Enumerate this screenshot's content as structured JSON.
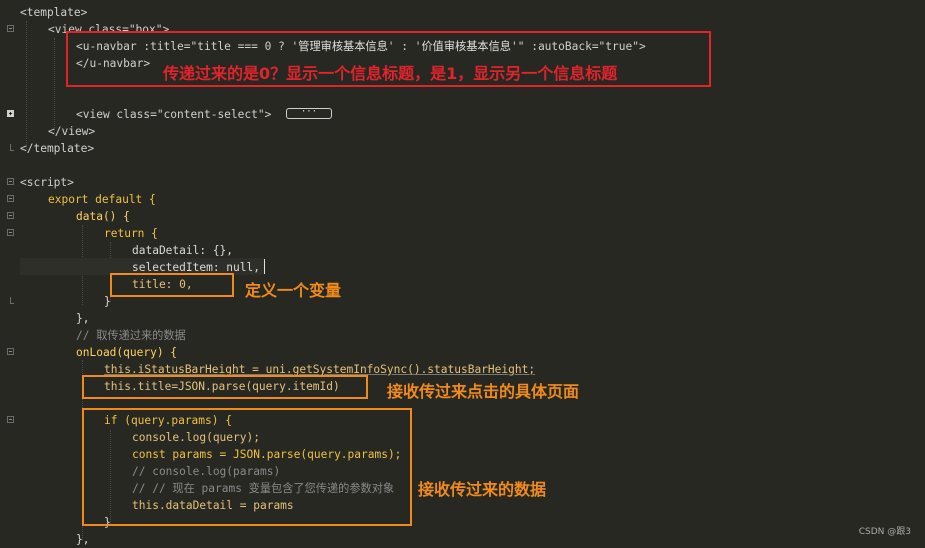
{
  "code": {
    "template_open": "<template>",
    "view_box": "<view class=\"box\">",
    "navbar_l1_a": "<u-navbar :title=\"title === 0 ? '",
    "navbar_l1_cn1": "管理审核基本信息",
    "navbar_l1_b": "' : '",
    "navbar_l1_cn2": "价值审核基本信息",
    "navbar_l1_c": "'\" :autoBack=\"true\">",
    "navbar_close": "</u-navbar>",
    "view_content": "<view class=\"content-select\">",
    "collapsed_marker": "···",
    "view_close": "</view>",
    "template_close": "</template>",
    "script_open": "<script>",
    "export_default": "export default {",
    "data_fn": "data() {",
    "return_open": "return {",
    "data_detail": "dataDetail: {},",
    "selected_item": "selectedItem: null,",
    "title_prop": "title: 0,",
    "close_brace": "}",
    "close_brace_comma": "},",
    "comment_fetch": "// 取传递过来的数据",
    "onload": "onLoad(query) {",
    "status_bar": "this.iStatusBarHeight = uni.getSystemInfoSync().statusBarHeight;",
    "this_title": "this.title=JSON.parse(query.itemId)",
    "if_params": "if (query.params) {",
    "console_log": "console.log(query);",
    "const_params": "const params = JSON.parse(query.params);",
    "comment_console": "// console.log(params)",
    "comment_now": "// // 现在 params 变量包含了您传递的参数对象",
    "data_detail_assign": "this.dataDetail = params",
    "if_close": "}",
    "last_brace": "},"
  },
  "annotations": {
    "title_explain": "传递过来的是0？显示一个信息标题，是1，显示另一个信息标题",
    "define_var": "定义一个变量",
    "receive_page": "接收传过来点击的具体页面",
    "receive_data": "接收传过来的数据"
  },
  "watermark": "CSDN @跟3",
  "colors": {
    "background": "#272822",
    "red_box": "#e0242b",
    "orange_box": "#f08a1c"
  }
}
